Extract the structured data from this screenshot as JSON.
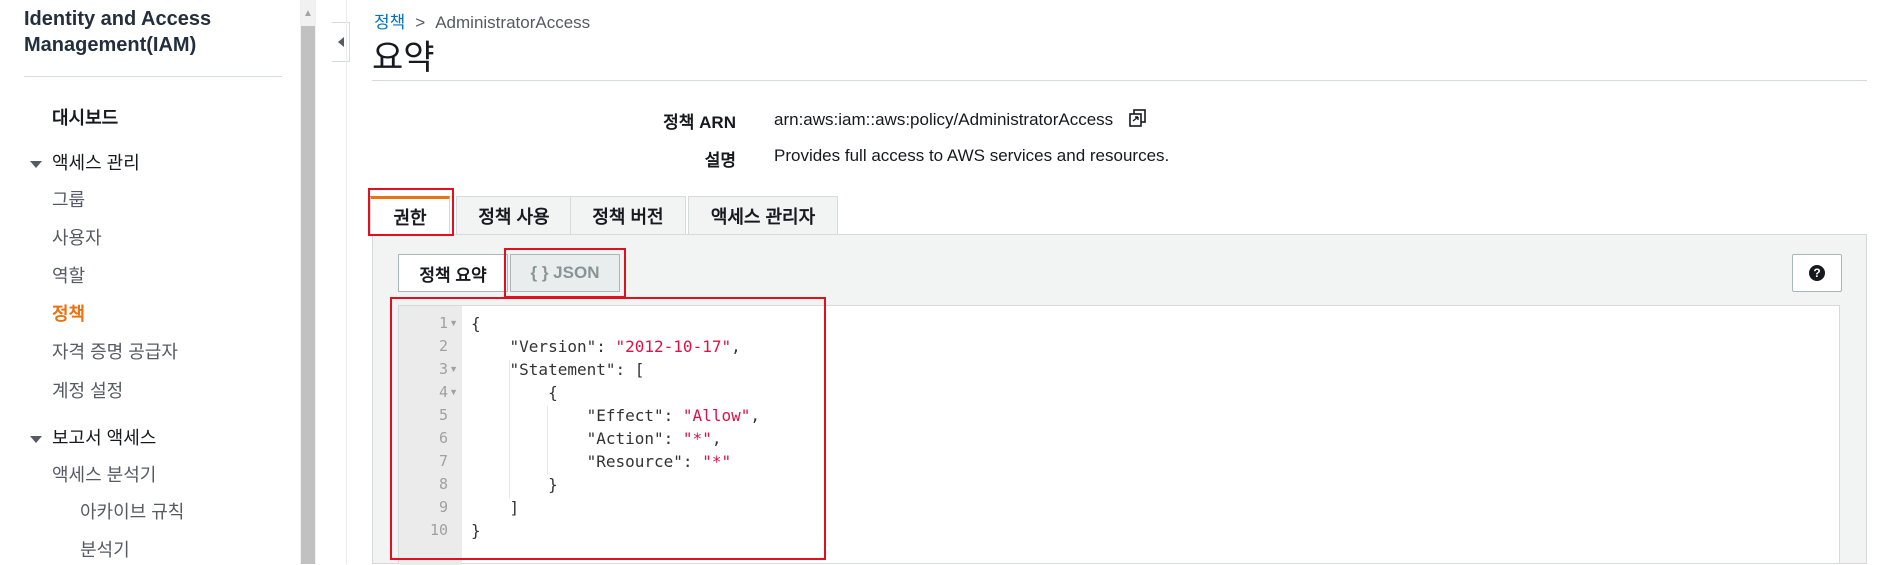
{
  "sidebar": {
    "title": "Identity and Access Management(IAM)",
    "items": [
      {
        "label": "대시보드",
        "style": "bold"
      },
      {
        "label": "액세스 관리",
        "style": "section"
      },
      {
        "label": "그룹",
        "style": "normal"
      },
      {
        "label": "사용자",
        "style": "normal"
      },
      {
        "label": "역할",
        "style": "normal"
      },
      {
        "label": "정책",
        "style": "active"
      },
      {
        "label": "자격 증명 공급자",
        "style": "normal"
      },
      {
        "label": "계정 설정",
        "style": "normal"
      },
      {
        "label": "보고서 액세스",
        "style": "section"
      },
      {
        "label": "액세스 분석기",
        "style": "normal"
      },
      {
        "label": "아카이브 규칙",
        "style": "sub"
      },
      {
        "label": "분석기",
        "style": "sub"
      }
    ]
  },
  "breadcrumb": {
    "parent": "정책",
    "separator": ">",
    "current": "AdministratorAccess"
  },
  "page_title": "요약",
  "summary": {
    "arn_label": "정책 ARN",
    "arn_value": "arn:aws:iam::aws:policy/AdministratorAccess",
    "description_label": "설명",
    "description_value": "Provides full access to AWS services and resources."
  },
  "tabs": [
    {
      "label": "권한",
      "active": true
    },
    {
      "label": "정책 사용",
      "active": false
    },
    {
      "label": "정책 버전",
      "active": false
    },
    {
      "label": "액세스 관리자",
      "active": false
    }
  ],
  "view_toggle": {
    "summary_label": "정책 요약",
    "json_label": "{ } JSON",
    "selected": "json"
  },
  "help_icon": "question-circle-icon",
  "editor": {
    "line_numbers": [
      "1",
      "2",
      "3",
      "4",
      "5",
      "6",
      "7",
      "8",
      "9",
      "10"
    ],
    "lines": [
      {
        "pre": "{",
        "str": "",
        "post": ""
      },
      {
        "pre": "    \"Version\": ",
        "str": "\"2012-10-17\"",
        "post": ","
      },
      {
        "pre": "    \"Statement\": [",
        "str": "",
        "post": ""
      },
      {
        "pre": "        {",
        "str": "",
        "post": ""
      },
      {
        "pre": "            \"Effect\": ",
        "str": "\"Allow\"",
        "post": ","
      },
      {
        "pre": "            \"Action\": ",
        "str": "\"*\"",
        "post": ","
      },
      {
        "pre": "            \"Resource\": ",
        "str": "\"*\"",
        "post": ""
      },
      {
        "pre": "        }",
        "str": "",
        "post": ""
      },
      {
        "pre": "    ]",
        "str": "",
        "post": ""
      },
      {
        "pre": "}",
        "str": "",
        "post": ""
      }
    ]
  },
  "colors": {
    "accent": "#ec7211",
    "link": "#0073bb",
    "highlight": "#e0101f",
    "json_string": "#dd1144"
  }
}
